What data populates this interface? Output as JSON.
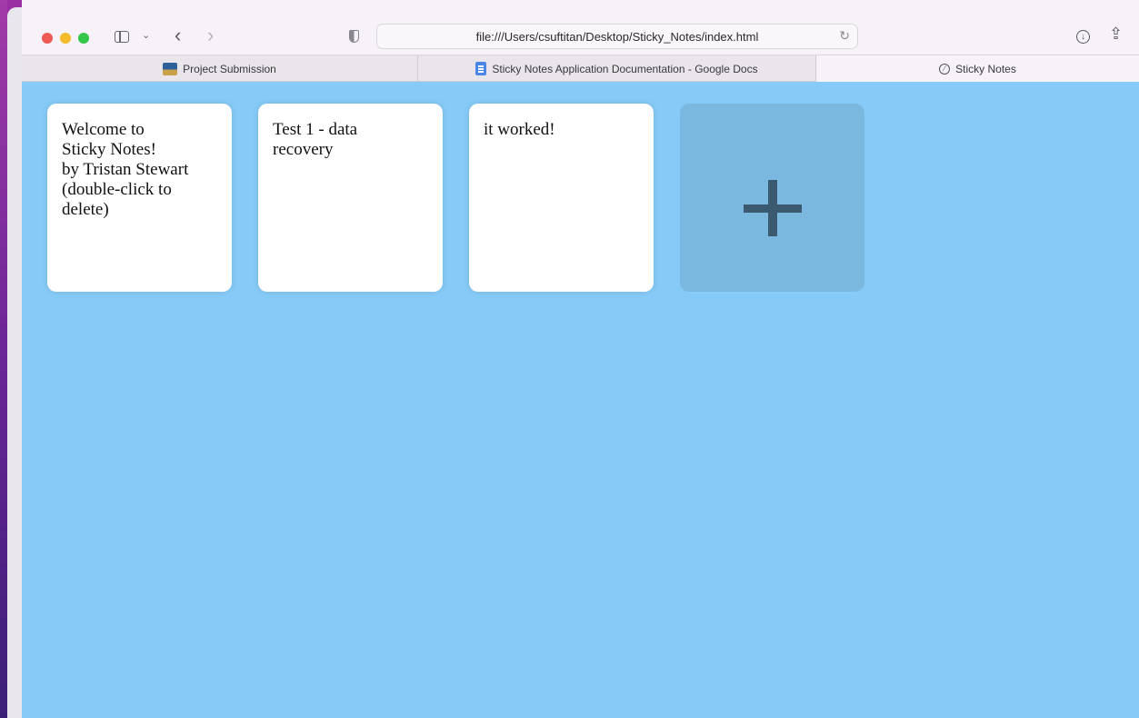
{
  "browser": {
    "url": "file:///Users/csuftitan/Desktop/Sticky_Notes/index.html"
  },
  "tabs": [
    {
      "label": "Project Submission",
      "icon": "project-favicon"
    },
    {
      "label": "Sticky Notes Application Documentation - Google Docs",
      "icon": "google-docs-icon"
    },
    {
      "label": "Sticky Notes",
      "icon": "compass-icon",
      "active": true
    }
  ],
  "notes": [
    {
      "text": "Welcome to\nSticky Notes!\nby Tristan Stewart\n(double-click to\ndelete)"
    },
    {
      "text": "Test 1 - data\nrecovery"
    },
    {
      "text": "it worked!"
    }
  ],
  "add_button": {
    "label": "+"
  },
  "colors": {
    "background": "#86cbf7",
    "note": "#ffffff",
    "add_button": "#7ab8df",
    "plus": "#3b5a70"
  }
}
